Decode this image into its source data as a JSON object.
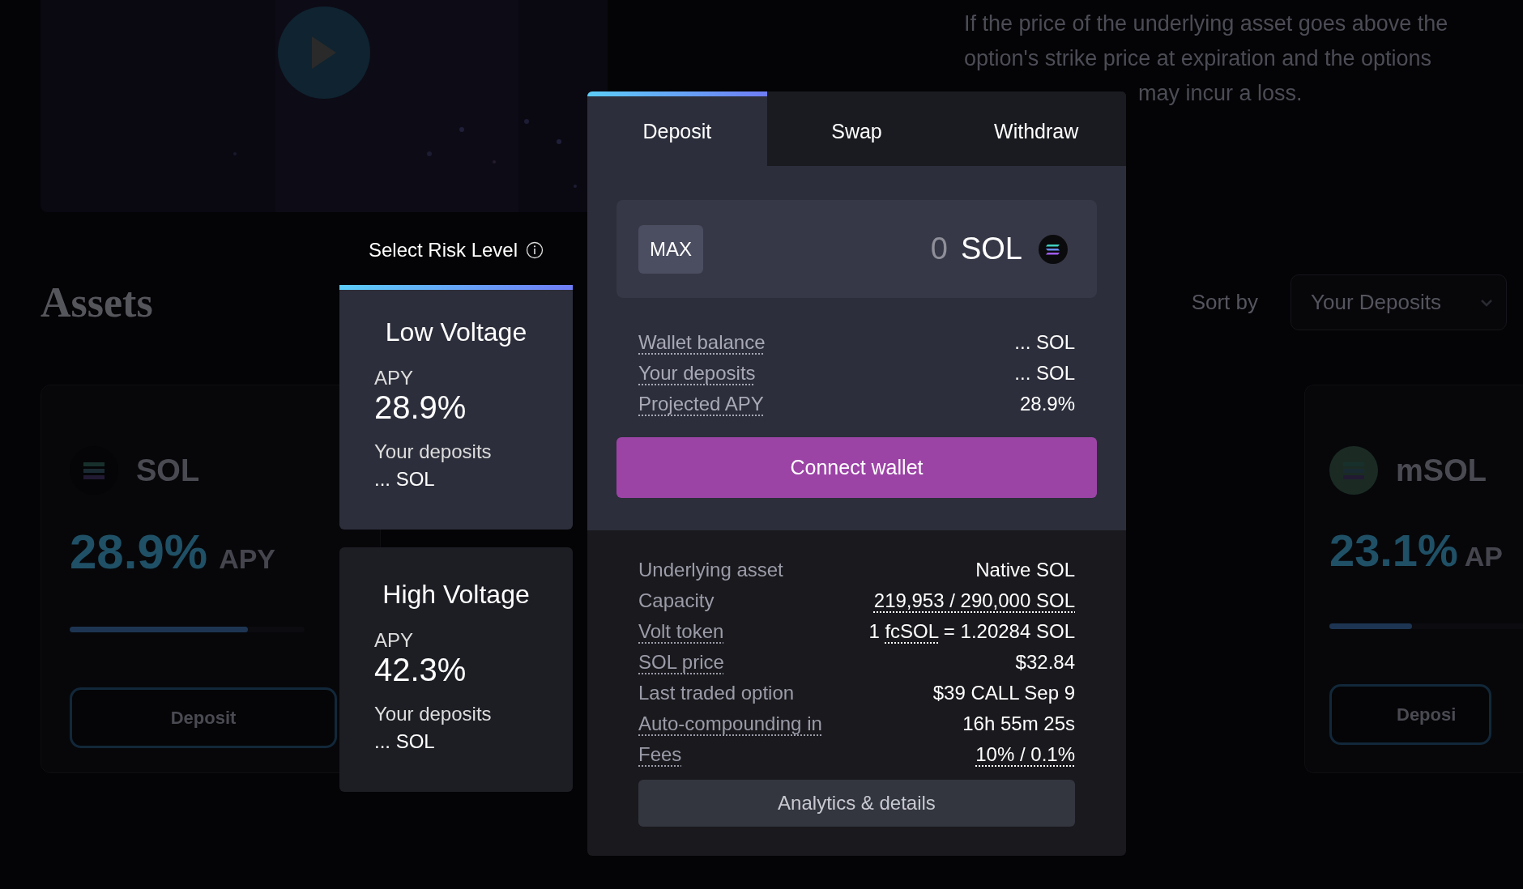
{
  "background": {
    "notice_lines": [
      "If the price of the underlying asset goes above the",
      "option's strike price at expiration and the options",
      "may incur a loss."
    ],
    "heading": "Assets",
    "sort": {
      "label": "Sort by",
      "value": "Your Deposits"
    },
    "asset_cards": [
      {
        "token": "SOL",
        "apy": "28.9%",
        "apy_unit": "APY",
        "button": "Deposit",
        "level": 0.76
      },
      {
        "token": "mSOL",
        "apy": "23.1%",
        "apy_unit": "AP",
        "button": "Deposi",
        "level": 0.35
      }
    ]
  },
  "risk": {
    "title": "Select Risk Level",
    "levels": [
      {
        "name": "Low Voltage",
        "apy_label": "APY",
        "apy": "28.9%",
        "deposits_label": "Your deposits",
        "deposits": "... SOL",
        "selected": true
      },
      {
        "name": "High Voltage",
        "apy_label": "APY",
        "apy": "42.3%",
        "deposits_label": "Your deposits",
        "deposits": "... SOL",
        "selected": false
      }
    ]
  },
  "panel": {
    "tabs": [
      {
        "label": "Deposit",
        "selected": true
      },
      {
        "label": "Swap",
        "selected": false
      },
      {
        "label": "Withdraw",
        "selected": false
      }
    ],
    "max": "MAX",
    "amount": "0",
    "unit": "SOL",
    "stats": [
      {
        "label": "Wallet balance",
        "dotted": true,
        "value": [
          {
            "text": "... SOL",
            "dotted": false
          }
        ]
      },
      {
        "label": "Your deposits",
        "dotted": true,
        "value": [
          {
            "text": "... SOL",
            "dotted": false
          }
        ]
      },
      {
        "label": "Projected APY",
        "dotted": true,
        "value": [
          {
            "text": "28.9%",
            "dotted": false
          }
        ]
      }
    ],
    "connect": "Connect wallet",
    "details": [
      {
        "label": "Underlying asset",
        "dotted": false,
        "value": [
          {
            "text": "Native SOL",
            "dotted": false
          }
        ]
      },
      {
        "label": "Capacity",
        "dotted": false,
        "value": [
          {
            "text": "219,953 / 290,000 SOL",
            "dotted": true
          }
        ]
      },
      {
        "label": "Volt token",
        "dotted": true,
        "value": [
          {
            "text": "1 ",
            "dotted": false
          },
          {
            "text": "fcSOL",
            "dotted": true
          },
          {
            "text": " = 1.20284 SOL",
            "dotted": false
          }
        ]
      },
      {
        "label": "SOL price",
        "dotted": true,
        "value": [
          {
            "text": "$32.84",
            "dotted": false
          }
        ]
      },
      {
        "label": "Last traded option",
        "dotted": false,
        "value": [
          {
            "text": "$39 CALL Sep 9",
            "dotted": false
          }
        ]
      },
      {
        "label": "Auto-compounding in",
        "dotted": true,
        "value": [
          {
            "text": "16h 55m 25s",
            "dotted": false
          }
        ]
      },
      {
        "label": "Fees",
        "dotted": true,
        "value": [
          {
            "text": "10% / 0.1%",
            "dotted": true
          }
        ]
      }
    ],
    "analytics": "Analytics & details"
  }
}
